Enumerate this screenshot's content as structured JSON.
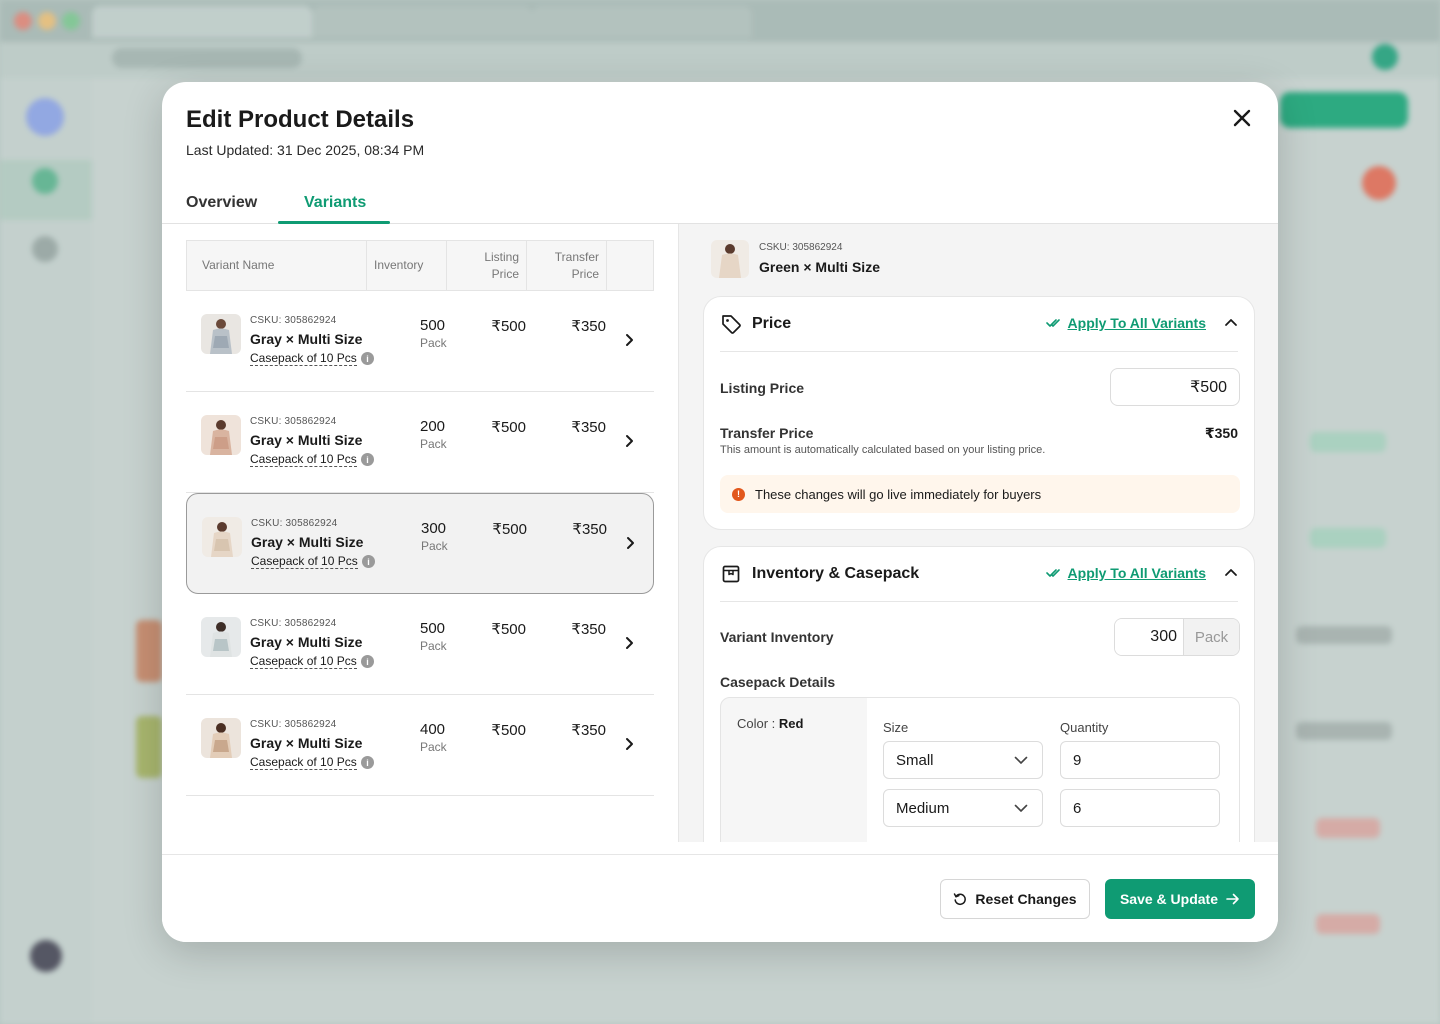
{
  "modal": {
    "title": "Edit Product Details",
    "last_updated": "Last Updated: 31 Dec 2025, 08:34 PM"
  },
  "tabs": [
    {
      "label": "Overview",
      "active": false
    },
    {
      "label": "Variants",
      "active": true
    }
  ],
  "table": {
    "headers": {
      "variant_name": "Variant Name",
      "inventory": "Inventory",
      "listing_price_1": "Listing",
      "listing_price_2": "Price",
      "transfer_price_1": "Transfer",
      "transfer_price_2": "Price"
    },
    "rows": [
      {
        "csku": "CSKU: 305862924",
        "name": "Gray × Multi Size",
        "casepack": "Casepack of 10 Pcs",
        "inventory": "500",
        "unit": "Pack",
        "listing_price": "₹500",
        "transfer_price": "₹350",
        "selected": false
      },
      {
        "csku": "CSKU: 305862924",
        "name": "Gray × Multi Size",
        "casepack": "Casepack of 10 Pcs",
        "inventory": "200",
        "unit": "Pack",
        "listing_price": "₹500",
        "transfer_price": "₹350",
        "selected": false
      },
      {
        "csku": "CSKU: 305862924",
        "name": "Gray × Multi Size",
        "casepack": "Casepack of 10 Pcs",
        "inventory": "300",
        "unit": "Pack",
        "listing_price": "₹500",
        "transfer_price": "₹350",
        "selected": true
      },
      {
        "csku": "CSKU: 305862924",
        "name": "Gray × Multi Size",
        "casepack": "Casepack of 10 Pcs",
        "inventory": "500",
        "unit": "Pack",
        "listing_price": "₹500",
        "transfer_price": "₹350",
        "selected": false
      },
      {
        "csku": "CSKU: 305862924",
        "name": "Gray × Multi Size",
        "casepack": "Casepack of 10 Pcs",
        "inventory": "400",
        "unit": "Pack",
        "listing_price": "₹500",
        "transfer_price": "₹350",
        "selected": false
      }
    ]
  },
  "detail": {
    "csku": "CSKU: 305862924",
    "name": "Green × Multi Size",
    "price_card": {
      "title": "Price",
      "apply_all": "Apply To All Variants",
      "listing_label": "Listing Price",
      "listing_value": "₹500",
      "transfer_label": "Transfer Price",
      "transfer_help": "This amount is automatically calculated based on your listing price.",
      "transfer_value": "₹350",
      "notice": "These changes will go live immediately for buyers"
    },
    "inventory_card": {
      "title": "Inventory & Casepack",
      "apply_all": "Apply To All Variants",
      "inventory_label": "Variant Inventory",
      "inventory_value": "300",
      "inventory_unit": "Pack",
      "casepack_label": "Casepack Details",
      "color_label": "Color : ",
      "color_value": "Red",
      "size_header": "Size",
      "qty_header": "Quantity",
      "lines": [
        {
          "size": "Small",
          "qty": "9"
        },
        {
          "size": "Medium",
          "qty": "6"
        }
      ]
    }
  },
  "footer": {
    "reset_label": "Reset Changes",
    "save_label": "Save & Update"
  },
  "colors": {
    "accent": "#0f9b73",
    "warning": "#e2571c",
    "notice_bg": "#fff6ec"
  }
}
